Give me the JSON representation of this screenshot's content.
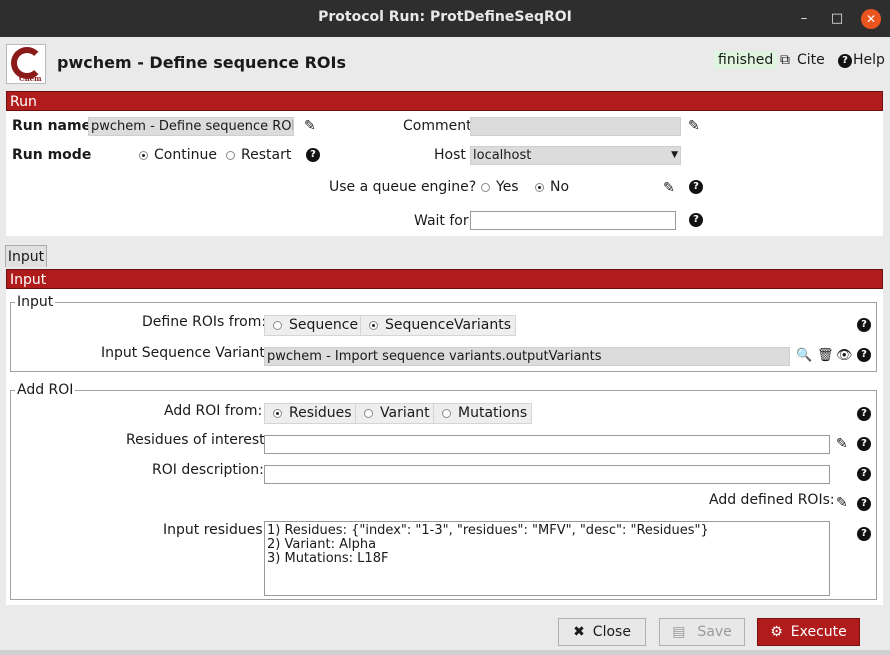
{
  "window": {
    "title": "Protocol Run: ProtDefineSeqROI",
    "minimize_glyph": "–",
    "maximize_glyph": "□",
    "close_glyph": "✕"
  },
  "header": {
    "logo_text": "Chem",
    "title": "pwchem - Define sequence ROIs",
    "status": "finished",
    "cite_label": "Cite",
    "help_label": "Help"
  },
  "run": {
    "section_label": "Run",
    "run_name_label": "Run name",
    "run_name_value": "pwchem - Define sequence ROIs",
    "comment_label": "Comment",
    "comment_value": "",
    "run_mode_label": "Run mode",
    "run_mode_options": [
      "Continue",
      "Restart"
    ],
    "run_mode_selected": "Continue",
    "host_label": "Host",
    "host_value": "localhost",
    "queue_label": "Use a queue engine?",
    "queue_options": [
      "Yes",
      "No"
    ],
    "queue_selected": "No",
    "wait_for_label": "Wait for",
    "wait_for_value": ""
  },
  "tabs": [
    "Input"
  ],
  "input_section": {
    "section_label": "Input",
    "group_label": "Input",
    "define_rois_label": "Define ROIs from:",
    "define_rois_options": [
      "Sequence",
      "SequenceVariants"
    ],
    "define_rois_selected": "SequenceVariants",
    "input_variants_label": "Input Sequence Variants:",
    "input_variants_value": "pwchem - Import sequence variants.outputVariants"
  },
  "add_roi": {
    "group_label": "Add ROI",
    "add_from_label": "Add ROI from:",
    "add_from_options": [
      "Residues",
      "Variant",
      "Mutations"
    ],
    "add_from_selected": "Residues",
    "residues_label": "Residues of interest:",
    "residues_value": "",
    "roi_desc_label": "ROI description:",
    "roi_desc_value": "",
    "add_defined_label": "Add defined ROIs:",
    "input_residues_label": "Input residues:",
    "input_residues_lines": [
      "1) Residues: {\"index\": \"1-3\", \"residues\": \"MFV\", \"desc\": \"Residues\"}",
      "2) Variant: Alpha",
      "3) Mutations: L18F"
    ]
  },
  "buttons": {
    "close": "Close",
    "save": "Save",
    "execute": "Execute"
  },
  "icons": {
    "help": "?",
    "edit": "✎",
    "search": "🔍",
    "trash": "🗑",
    "eye": "👁",
    "wand": "✎",
    "close_x": "✖",
    "gear": "⚙",
    "save": "▤",
    "cite": "⧉",
    "help_round": "?"
  },
  "colors": {
    "accent": "#b01c1c",
    "status_bg": "#dff5df"
  }
}
